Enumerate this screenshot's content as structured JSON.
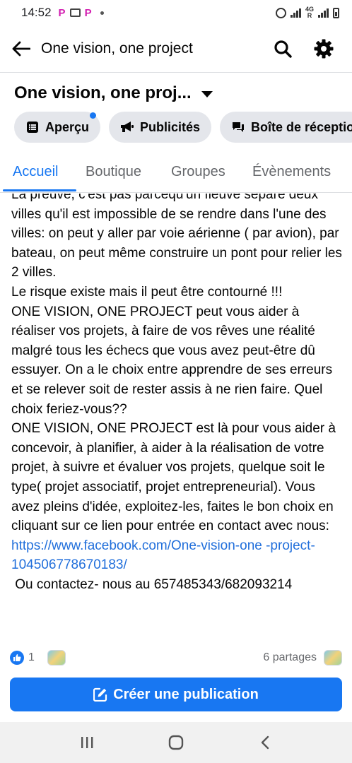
{
  "status_bar": {
    "time": "14:52",
    "app_icons": [
      "P",
      "P"
    ],
    "network": "4G",
    "network_sub": "R"
  },
  "app_bar": {
    "title": "One vision, one project",
    "icons": [
      "back-arrow-icon",
      "search-icon",
      "gear-icon"
    ]
  },
  "page_header": {
    "name": "One vision, one proj...",
    "chips": [
      {
        "label": "Aperçu",
        "icon": "overview-icon",
        "has_dot": true
      },
      {
        "label": "Publicités",
        "icon": "megaphone-icon",
        "has_dot": false
      },
      {
        "label": "Boîte de réceptio",
        "icon": "chat-bubble-icon",
        "has_dot": false
      }
    ]
  },
  "tabs": [
    {
      "label": "Accueil",
      "active": true
    },
    {
      "label": "Boutique",
      "active": false
    },
    {
      "label": "Groupes",
      "active": false
    },
    {
      "label": "Évènements",
      "active": false
    }
  ],
  "post": {
    "paragraph_1": "La preuve, c'est pas parcequ'un fleuve sépare deux villes qu'il est impossible de se rendre dans l'une des villes: on peut y aller par voie aérienne ( par avion), par bateau, on peut même construire un pont pour relier les 2 villes.",
    "paragraph_2": "Le risque existe mais il peut être contourné !!!",
    "paragraph_3": "ONE VISION, ONE PROJECT peut vous aider à réaliser vos projets, à faire de vos rêves une réalité malgré tous les échecs que vous avez peut-être dû essuyer. On a le choix entre apprendre de ses erreurs et se relever soit de rester assis à ne rien faire. Quel choix feriez-vous??",
    "paragraph_4": "ONE VISION, ONE PROJECT est là pour vous aider à concevoir, à planifier, à aider à la réalisation de votre projet, à suivre et évaluer vos projets, quelque soit le type( projet associatif, projet entrepreneurial). Vous avez pleins d'idée, exploitez-les, faites le bon choix en cliquant sur ce lien pour entrée en contact avec nous:",
    "link": "https://www.facebook.com/One-vision-one -project-104506778670183/",
    "contact": " Ou contactez- nous au 657485343/682093214"
  },
  "reactions": {
    "like_count": "1",
    "shares": "6 partages"
  },
  "create_button": {
    "label": "Créer une publication"
  },
  "colors": {
    "facebook_blue": "#1877f2",
    "link_blue": "#216fdb",
    "chip_gray": "#e4e6eb",
    "secondary_text": "#65676b"
  }
}
